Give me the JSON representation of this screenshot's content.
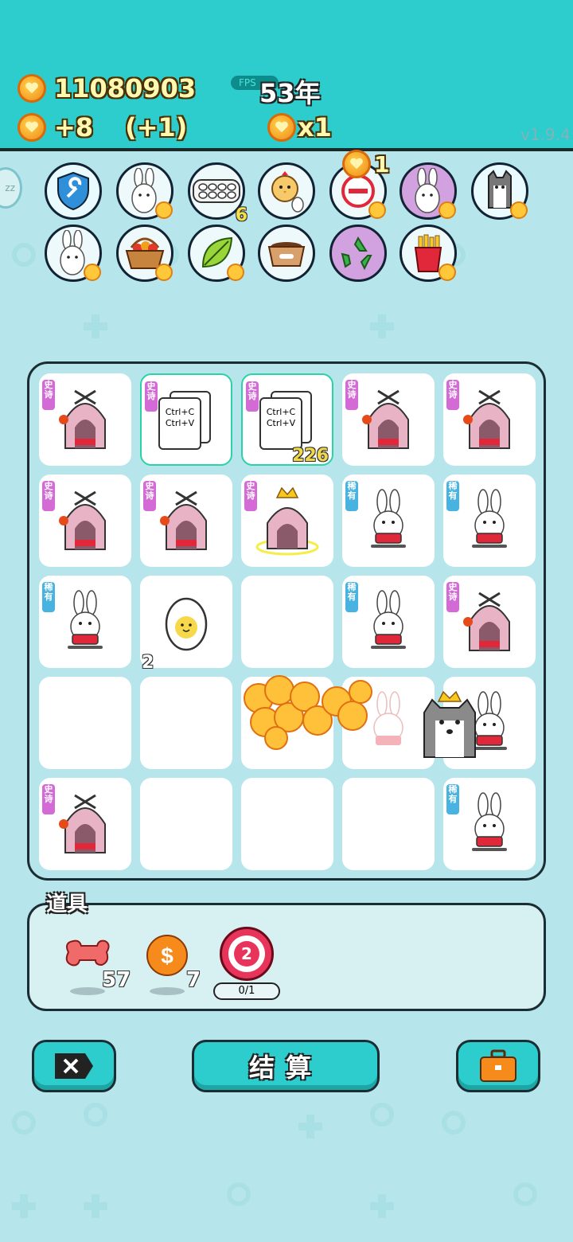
{
  "header": {
    "coins": "11080903",
    "income": "+8",
    "bonus": "(+1)",
    "fps_label": "FPS",
    "year": "53年",
    "multiplier": "x1",
    "version": "v1.9.4"
  },
  "symbols_row": [
    {
      "icon": "wrench-shield-icon"
    },
    {
      "icon": "bunny-icon"
    },
    {
      "icon": "egg-tray-icon",
      "count": "6"
    },
    {
      "icon": "chick-icon"
    },
    {
      "icon": "minus-remove-icon",
      "coin_count": "1"
    },
    {
      "icon": "purple-bunny-icon"
    },
    {
      "icon": "husky-icon"
    },
    {
      "icon": "bunny-alt-icon"
    },
    {
      "icon": "fruit-basket-icon"
    },
    {
      "icon": "leaf-icon"
    },
    {
      "icon": "dog-food-bowl-icon"
    },
    {
      "icon": "recycle-icon"
    },
    {
      "icon": "fries-icon"
    }
  ],
  "board": {
    "tags": {
      "epic": "史诗",
      "rare": "稀有"
    },
    "copy_text": {
      "line1": "Ctrl+C",
      "line2": "Ctrl+V"
    },
    "copy_count": "226",
    "egg_count": "2"
  },
  "inventory": {
    "title": "道具",
    "items": [
      {
        "icon": "bone-icon",
        "count": "57"
      },
      {
        "icon": "dollar-coin-icon",
        "count": "7"
      },
      {
        "icon": "target-icon",
        "value": "2",
        "progress": "0/1"
      }
    ]
  },
  "buttons": {
    "settle": "结算"
  }
}
